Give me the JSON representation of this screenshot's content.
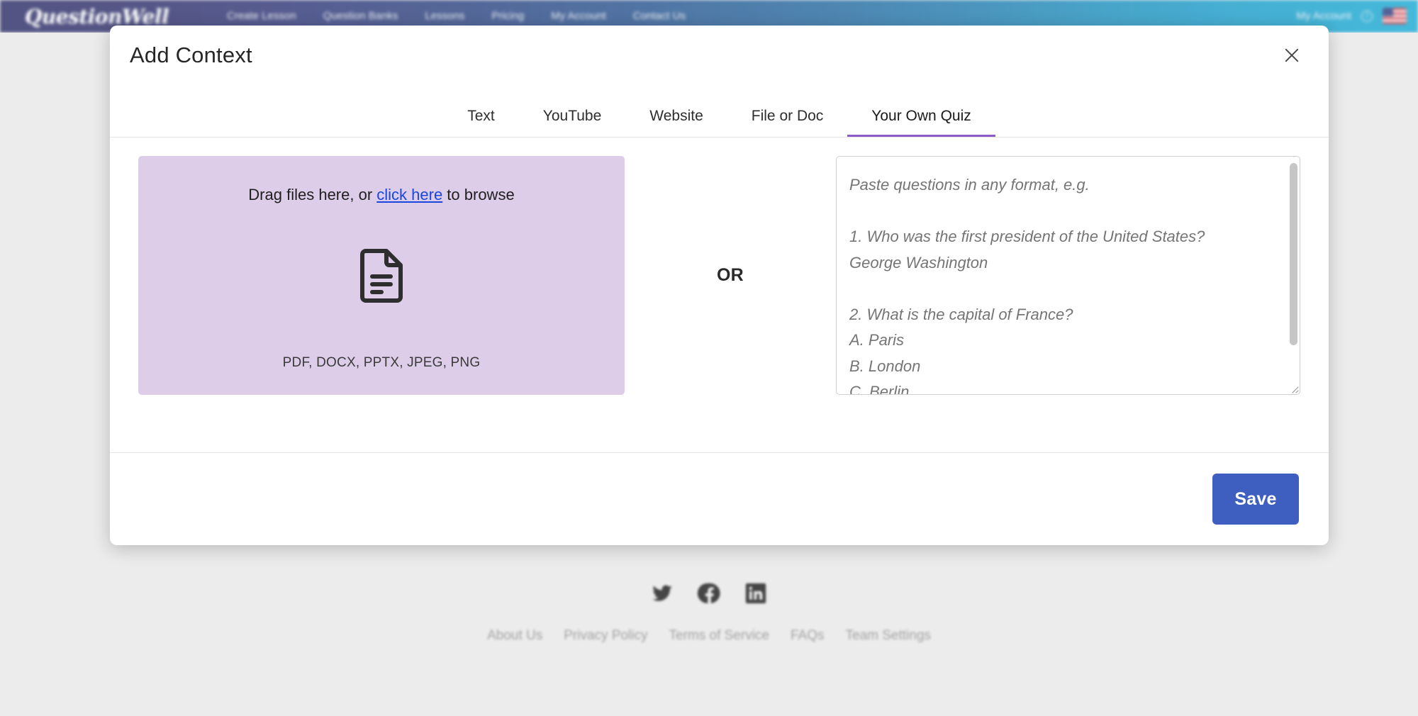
{
  "app": {
    "logo_text": "QuestionWell",
    "nav_items": [
      "Create Lesson",
      "Question Banks",
      "Lessons",
      "Pricing",
      "My Account",
      "Contact Us"
    ],
    "right": {
      "account_label": "My Account",
      "info_icon": "info-circle-icon",
      "flag_icon": "us-flag-icon"
    }
  },
  "modal": {
    "title": "Add Context",
    "close_icon": "close-icon",
    "tabs": [
      {
        "label": "Text",
        "active": false
      },
      {
        "label": "YouTube",
        "active": false
      },
      {
        "label": "Website",
        "active": false
      },
      {
        "label": "File or Doc",
        "active": false
      },
      {
        "label": "Your Own Quiz",
        "active": true
      }
    ],
    "active_tab": "Your Own Quiz",
    "dropzone": {
      "prompt_prefix": "Drag files here, or ",
      "link_text": "click here",
      "prompt_suffix": " to browse",
      "icon": "document-icon",
      "formats": "PDF, DOCX, PPTX, JPEG, PNG"
    },
    "divider_label": "OR",
    "textarea": {
      "value": "",
      "placeholder": "Paste questions in any format, e.g.\n\n1. Who was the first president of the United States?\nGeorge Washington\n\n2. What is the capital of France?\nA. Paris\nB. London\nC. Berlin",
      "scrollbar": "vertical-scrollbar",
      "resize_handle": "resize-grip-icon"
    },
    "save_label": "Save"
  },
  "footer": {
    "social": [
      {
        "name": "twitter-icon",
        "label": "Twitter"
      },
      {
        "name": "facebook-icon",
        "label": "Facebook"
      },
      {
        "name": "linkedin-icon",
        "label": "LinkedIn"
      }
    ],
    "links": [
      "About Us",
      "Privacy Policy",
      "Terms of Service",
      "FAQs",
      "Team Settings"
    ]
  },
  "colors": {
    "accent_purple": "#8b5cc7",
    "dropzone_lavender": "#ddcde9",
    "save_blue": "#3f5fc0",
    "link_blue": "#1a46e0",
    "header_gradient_start": "#3b3b72",
    "header_gradient_end": "#28afd6"
  }
}
